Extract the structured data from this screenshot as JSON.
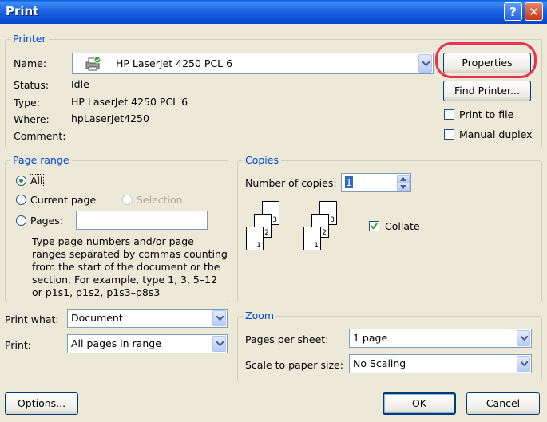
{
  "window": {
    "title": "Print"
  },
  "titlebar": {
    "help": "?",
    "close": "✕"
  },
  "printer": {
    "group_label": "Printer",
    "name_label": "Name:",
    "name_value": "HP LaserJet 4250 PCL 6",
    "status_label": "Status:",
    "status_value": "Idle",
    "type_label": "Type:",
    "type_value": "HP LaserJet 4250 PCL 6",
    "where_label": "Where:",
    "where_value": "hpLaserJet4250",
    "comment_label": "Comment:",
    "comment_value": "",
    "properties_button": "Properties",
    "find_printer_button": "Find Printer...",
    "print_to_file_label": "Print to file",
    "print_to_file_checked": false,
    "manual_duplex_label": "Manual duplex",
    "manual_duplex_checked": false
  },
  "page_range": {
    "group_label": "Page range",
    "all_label": "All",
    "current_page_label": "Current page",
    "selection_label": "Selection",
    "pages_label": "Pages:",
    "pages_value": "",
    "selected": "All",
    "help_text": "Type page numbers and/or page ranges separated by commas counting from the start of the document or the section. For example, type 1, 3, 5–12 or p1s1, p1s2, p1s3–p8s3"
  },
  "copies": {
    "group_label": "Copies",
    "number_label": "Number of copies:",
    "number_value": "1",
    "collate_label": "Collate",
    "collate_checked": true,
    "page_labels": [
      "1",
      "2",
      "3"
    ]
  },
  "print_what": {
    "label": "Print what:",
    "value": "Document"
  },
  "print": {
    "label": "Print:",
    "value": "All pages in range"
  },
  "zoom": {
    "group_label": "Zoom",
    "pages_per_sheet_label": "Pages per sheet:",
    "pages_per_sheet_value": "1 page",
    "scale_label": "Scale to paper size:",
    "scale_value": "No Scaling"
  },
  "footer": {
    "options_button": "Options...",
    "ok_button": "OK",
    "cancel_button": "Cancel"
  },
  "colors": {
    "titlebar": "#0A50D8",
    "group_label": "#0046D5",
    "annotation": "#E8324F",
    "face": "#ECE9D8"
  }
}
